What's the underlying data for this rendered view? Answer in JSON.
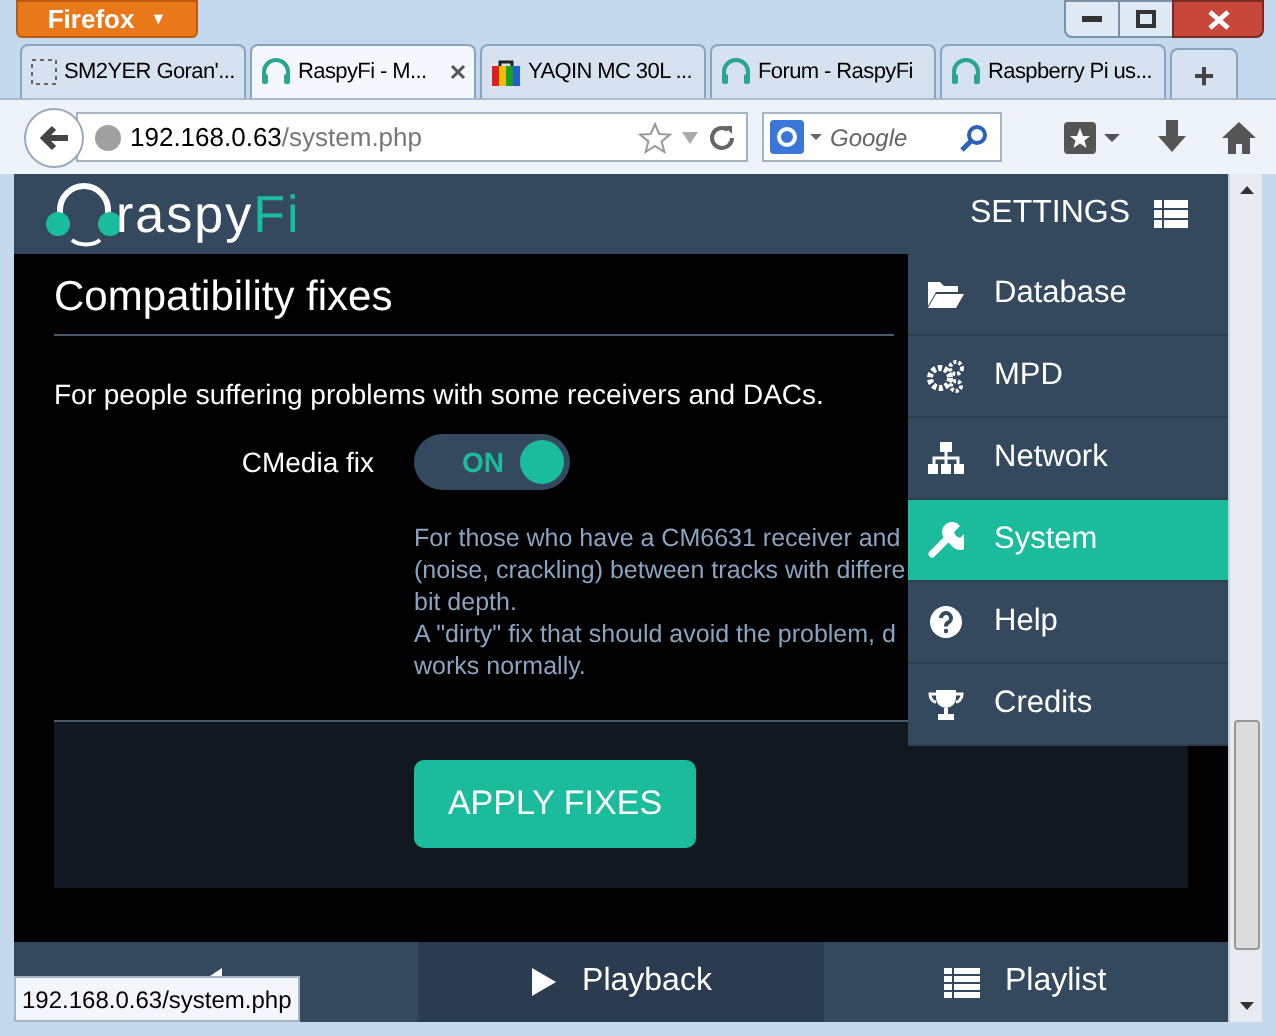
{
  "browser": {
    "menu_button": "Firefox",
    "menu_caret": "▼",
    "tabs": [
      {
        "label": "SM2YER Goran'...",
        "kind": "blank",
        "selected": false
      },
      {
        "label": "RaspyFi - M...",
        "kind": "headphones",
        "selected": true
      },
      {
        "label": "YAQIN MC 30L ...",
        "kind": "bag",
        "selected": false
      },
      {
        "label": "Forum - RaspyFi",
        "kind": "headphones",
        "selected": false
      },
      {
        "label": "Raspberry Pi us...",
        "kind": "headphones",
        "selected": false
      }
    ],
    "new_tab": "+",
    "address": {
      "host": "192.168.0.63",
      "path": "/system.php"
    },
    "search": {
      "placeholder": "Google"
    },
    "status_url": "192.168.0.63/system.php"
  },
  "app": {
    "logo": {
      "text": "raspy",
      "accent": "Fi"
    },
    "header_label": "SETTINGS",
    "section_title": "Compatibility fixes",
    "intro": "For people suffering problems with some receivers and DACs.",
    "settings": [
      {
        "label": "CMedia fix",
        "on": true,
        "toggle_label": "ON",
        "description_lines": [
          "For those who have a CM6631 receiver and",
          "(noise, crackling) between tracks with differe",
          "bit depth.",
          "A \"dirty\" fix that should avoid the problem, d",
          "works normally."
        ]
      }
    ],
    "apply_button": "APPLY FIXES",
    "menu": [
      {
        "label": "Database",
        "kind": "folder",
        "selected": false
      },
      {
        "label": "MPD",
        "kind": "gears",
        "selected": false
      },
      {
        "label": "Network",
        "kind": "sitemap",
        "selected": false
      },
      {
        "label": "System",
        "kind": "wrench",
        "selected": true
      },
      {
        "label": "Help",
        "kind": "question",
        "selected": false
      },
      {
        "label": "Credits",
        "kind": "trophy",
        "selected": false
      }
    ],
    "bottom_nav": [
      {
        "kind": "browse",
        "selected": false
      },
      {
        "kind": "playback",
        "label": "Playback",
        "selected": true
      },
      {
        "kind": "playlist",
        "label": "Playlist",
        "selected": false
      }
    ]
  }
}
